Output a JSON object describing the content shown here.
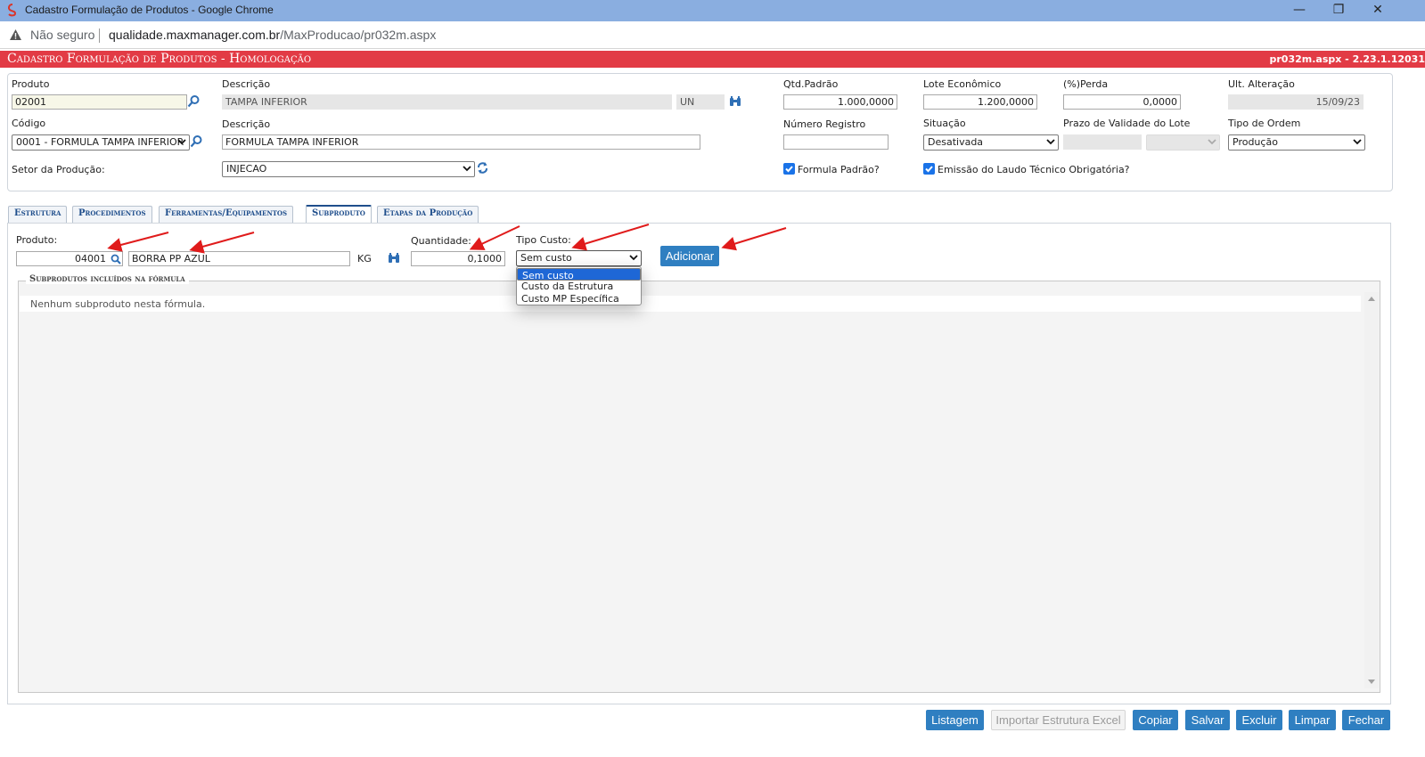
{
  "browser": {
    "window_title": "Cadastro Formulação de Produtos - Google Chrome",
    "not_secure": "Não seguro",
    "url_domain": "qualidade.maxmanager.com.br",
    "url_path": "/MaxProducao/pr032m.aspx",
    "minimize": "—",
    "restore": "❐",
    "close": "✕"
  },
  "header": {
    "title": "Cadastro Formulação de Produtos  - Homologação",
    "version": "pr032m.aspx - 2.23.1.12031"
  },
  "form": {
    "produto_label": "Produto",
    "produto_value": "02001",
    "descricao_label": "Descrição",
    "descricao_value": "TAMPA INFERIOR",
    "unidade_value": "UN",
    "qtd_padrao_label": "Qtd.Padrão",
    "qtd_padrao_value": "1.000,0000",
    "lote_economico_label": "Lote Econômico",
    "lote_economico_value": "1.200,0000",
    "perda_label": "(%)Perda",
    "perda_value": "0,0000",
    "ult_alteracao_label": "Ult. Alteração",
    "ult_alteracao_value": "15/09/23",
    "codigo_label": "Código",
    "codigo_value": "0001 - FORMULA TAMPA INFERIOR",
    "descricao2_label": "Descrição",
    "descricao2_value": "FORMULA TAMPA INFERIOR",
    "numero_registro_label": "Número Registro",
    "numero_registro_value": "",
    "situacao_label": "Situação",
    "situacao_value": "Desativada",
    "prazo_validade_label": "Prazo de Validade do Lote",
    "tipo_ordem_label": "Tipo de Ordem",
    "tipo_ordem_value": "Produção",
    "setor_label": "Setor da Produção:",
    "setor_value": "INJECAO",
    "formula_padrao_label": "Formula Padrão?",
    "formula_padrao_checked": true,
    "emissao_laudo_label": "Emissão do Laudo Técnico Obrigatória?",
    "emissao_laudo_checked": true
  },
  "tabs": [
    {
      "label": "Estrutura",
      "active": false
    },
    {
      "label": "Procedimentos",
      "active": false
    },
    {
      "label": "Ferramentas/Equipamentos",
      "active": false
    },
    {
      "label": "Subproduto",
      "active": true
    },
    {
      "label": "Etapas da Produção",
      "active": false
    }
  ],
  "subproduto": {
    "produto_label": "Produto:",
    "produto_code": "04001",
    "produto_desc": "BORRA PP AZUL",
    "unidade": "KG",
    "quantidade_label": "Quantidade:",
    "quantidade_value": "0,1000",
    "tipo_custo_label": "Tipo Custo:",
    "tipo_custo_value": "Sem custo",
    "tipo_custo_options": [
      "Sem custo",
      "Custo da Estrutura",
      "Custo MP Específica"
    ],
    "adicionar_label": "Adicionar",
    "fieldset_title": "Subprodutos incluídos na fórmula",
    "empty_message": "Nenhum subproduto nesta fórmula."
  },
  "footer_buttons": {
    "listagem": "Listagem",
    "importar": "Importar Estrutura Excel",
    "copiar": "Copiar",
    "salvar": "Salvar",
    "excluir": "Excluir",
    "limpar": "Limpar",
    "fechar": "Fechar"
  },
  "colors": {
    "header_red": "#e23b45",
    "button_blue": "#2f7fc1",
    "tab_text": "#1f4e8c",
    "annotation_red": "#e01b1b",
    "chrome_titlebar": "#8aaee0"
  },
  "icons": [
    "search-icon",
    "binoculars-icon",
    "refresh-icon",
    "chevron-down-icon",
    "warning-icon",
    "chrome-logo-icon"
  ]
}
